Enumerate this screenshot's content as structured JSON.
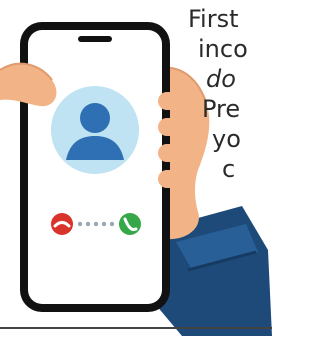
{
  "text": {
    "line1": "First",
    "line2": "inco",
    "line3": "do",
    "line4": "Pre",
    "line5": "yo",
    "line6": "c"
  },
  "icons": {
    "decline": "phone-decline-icon",
    "accept": "phone-accept-icon",
    "avatar": "user-avatar-icon"
  },
  "colors": {
    "decline": "#d9342b",
    "accept": "#37a84a",
    "avatar_bg": "#bfe3f2",
    "skin": "#f2b487",
    "sleeve": "#1e4a7a",
    "phone_body": "#111111"
  }
}
